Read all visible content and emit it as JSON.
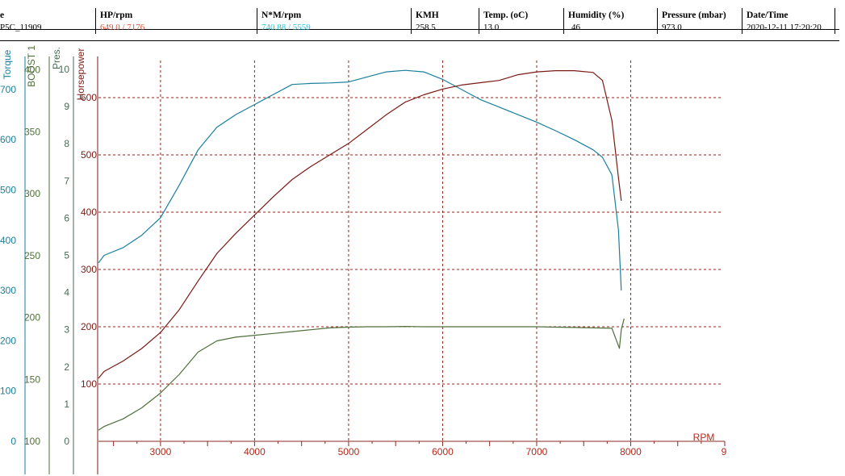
{
  "header": {
    "columns": [
      {
        "label": "e",
        "value": "P5C_11909",
        "color": "#000000"
      },
      {
        "label": "HP/rpm",
        "value": "649.0 / 7176",
        "color": "#e0533a"
      },
      {
        "label": "N*M/rpm",
        "value": "740.88 / 5559",
        "color": "#22c7d6"
      },
      {
        "label": "KMH",
        "value": "258.5",
        "color": "#000000"
      },
      {
        "label": "Temp. (oC)",
        "value": "13.0",
        "color": "#000000"
      },
      {
        "label": "Humidity (%)",
        "value": "46",
        "color": "#000000"
      },
      {
        "label": "Pressure (mbar)",
        "value": "973.0",
        "color": "#000000"
      },
      {
        "label": "Date/Time",
        "value": "2020-12-11 17:20:20",
        "color": "#000000"
      }
    ]
  },
  "colors": {
    "torque": "#1a7f9c",
    "horsepower": "#7a1a14",
    "boost": "#4f6f3a",
    "pres": "#4a6a55",
    "grid": "#8b2a20",
    "rpm": "#b02a1c"
  },
  "chart_data": {
    "type": "line",
    "xlabel": "RPM",
    "x_ticks": [
      "3000",
      "4000",
      "5000",
      "6000",
      "7000",
      "8000",
      "9"
    ],
    "xlim": [
      2340,
      9000
    ],
    "grid": true,
    "axes": [
      {
        "name": "Torque",
        "ticks": [
          "0",
          "100",
          "200",
          "300",
          "400",
          "500",
          "600",
          "700"
        ],
        "ylim": [
          0,
          775
        ]
      },
      {
        "name": "BOOST 1",
        "ticks": [
          "100",
          "150",
          "200",
          "250",
          "300",
          "350",
          "400"
        ],
        "ylim": [
          100,
          400
        ]
      },
      {
        "name": "Pres.",
        "ticks": [
          "0",
          "1",
          "2",
          "3",
          "4",
          "5",
          "6",
          "7",
          "8",
          "9",
          "10"
        ],
        "ylim": [
          0,
          10
        ]
      },
      {
        "name": "Horsepower",
        "ticks": [
          "100",
          "200",
          "300",
          "400",
          "500",
          "600"
        ],
        "ylim": [
          0,
          660
        ]
      }
    ],
    "series": [
      {
        "axis": "Torque",
        "x": [
          2340,
          2400,
          2600,
          2800,
          3000,
          3200,
          3400,
          3600,
          3800,
          4000,
          4200,
          4400,
          4600,
          4800,
          5000,
          5200,
          5400,
          5600,
          5800,
          6000,
          6200,
          6400,
          6600,
          6800,
          7000,
          7200,
          7400,
          7600,
          7700,
          7800,
          7870,
          7900
        ],
        "y": [
          355,
          370,
          385,
          410,
          445,
          510,
          580,
          625,
          650,
          670,
          690,
          710,
          712,
          713,
          715,
          725,
          735,
          738,
          735,
          720,
          700,
          680,
          665,
          650,
          635,
          618,
          600,
          580,
          565,
          530,
          420,
          300
        ]
      },
      {
        "axis": "Horsepower",
        "x": [
          2340,
          2400,
          2600,
          2800,
          3000,
          3200,
          3400,
          3600,
          3800,
          4000,
          4200,
          4400,
          4600,
          4800,
          5000,
          5200,
          5400,
          5600,
          5800,
          6000,
          6200,
          6400,
          6600,
          6800,
          7000,
          7200,
          7400,
          7600,
          7700,
          7800,
          7870,
          7900
        ],
        "y": [
          110,
          122,
          140,
          162,
          190,
          230,
          280,
          328,
          363,
          395,
          427,
          457,
          480,
          500,
          520,
          545,
          570,
          592,
          605,
          615,
          622,
          626,
          630,
          640,
          645,
          647,
          647,
          644,
          630,
          560,
          460,
          420
        ]
      },
      {
        "axis": "Pres.",
        "x": [
          2340,
          2400,
          2600,
          2800,
          3000,
          3200,
          3400,
          3600,
          3800,
          4000,
          4200,
          4400,
          4600,
          4800,
          5000,
          5200,
          5400,
          5600,
          5800,
          6000,
          6200,
          6400,
          6600,
          6800,
          7000,
          7200,
          7400,
          7600,
          7800,
          7880,
          7900,
          7930
        ],
        "y": [
          0.3,
          0.4,
          0.6,
          0.9,
          1.3,
          1.8,
          2.4,
          2.7,
          2.8,
          2.85,
          2.9,
          2.95,
          3.0,
          3.05,
          3.07,
          3.08,
          3.08,
          3.09,
          3.08,
          3.08,
          3.08,
          3.08,
          3.08,
          3.08,
          3.08,
          3.07,
          3.06,
          3.05,
          3.04,
          2.5,
          3.0,
          3.3
        ]
      }
    ]
  }
}
